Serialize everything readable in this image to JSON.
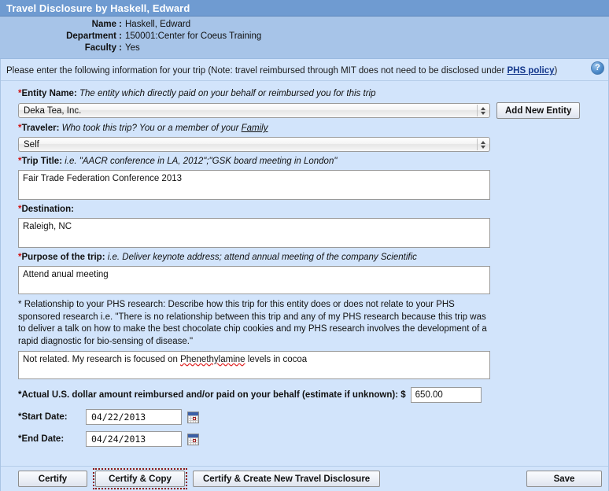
{
  "window": {
    "title": "Travel Disclosure by Haskell, Edward"
  },
  "info": {
    "rows": [
      {
        "label": "Name",
        "value": "Haskell, Edward"
      },
      {
        "label": "Department",
        "value": "150001:Center for Coeus Training"
      },
      {
        "label": "Faculty",
        "value": "Yes"
      }
    ]
  },
  "notice": {
    "text_before": "Please enter the following information for your trip (Note: travel reimbursed through MIT does not need to be disclosed under ",
    "link": "PHS policy",
    "text_after": ")",
    "help_icon": "question-mark-icon",
    "help_glyph": "?"
  },
  "fields": {
    "entity": {
      "required": "*",
      "label": "Entity Name:",
      "hint": "The entity which directly paid on your behalf or reimbursed you for this trip",
      "value": "Deka Tea, Inc.",
      "add_button": "Add New Entity"
    },
    "traveler": {
      "required": "*",
      "label": "Traveler:",
      "hint_before": "Who took this trip? You or a member of your ",
      "hint_link": "Family",
      "value": "Self"
    },
    "trip_title": {
      "required": "*",
      "label": "Trip Title:",
      "hint": "i.e. \"AACR conference in LA, 2012\";\"GSK board meeting in London\"",
      "value": "Fair Trade Federation Conference 2013"
    },
    "destination": {
      "required": "*",
      "label": "Destination:",
      "value": "Raleigh, NC"
    },
    "purpose": {
      "required": "*",
      "label": "Purpose of the trip:",
      "hint": "i.e. Deliver keynote address; attend annual meeting of the company Scientific",
      "value": "Attend anual meeting"
    },
    "relationship": {
      "required": "*",
      "label": "Relationship to your PHS research:",
      "hint": "Describe how this trip for this entity does or does not relate to your PHS sponsored research i.e. \"There is no relationship between this trip and any of my PHS research because this trip was to deliver a talk on how to make the best chocolate chip cookies and my PHS research involves the development of a rapid diagnostic for bio-sensing of disease.\"",
      "value_before": "Not related. My research is focused on ",
      "value_misspelled": "Phenethylamine",
      "value_after": " levels in cocoa"
    },
    "amount": {
      "required": "*",
      "label": "Actual U.S. dollar amount reimbursed and/or paid on your behalf (estimate if unknown): $",
      "value": "650.00"
    },
    "start_date": {
      "required": "*",
      "label": "Start Date:",
      "value": "04/22/2013",
      "picker_icon": "calendar-icon"
    },
    "end_date": {
      "required": "*",
      "label": "End Date:",
      "value": "04/24/2013",
      "picker_icon": "calendar-icon"
    }
  },
  "buttons": {
    "certify": "Certify",
    "certify_copy": "Certify & Copy",
    "certify_create": "Certify & Create  New Travel Disclosure",
    "save": "Save"
  },
  "colors": {
    "titlebar": "#6f9bd1",
    "info_panel": "#a7c4e8",
    "body": "#d2e4fb",
    "required_star": "#d01010",
    "link": "#14388c",
    "focus_outline": "#8b1a1a",
    "spellcheck": "#e02020"
  }
}
